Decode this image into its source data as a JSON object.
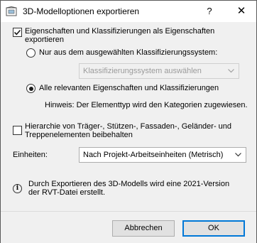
{
  "window": {
    "title": "3D-Modelloptionen exportieren",
    "help_label": "?",
    "close_label": "✕"
  },
  "export_properties": {
    "checked": true,
    "label_line1": "Eigenschaften und Klassifizierungen als Eigenschaften",
    "label_line2": "exportieren"
  },
  "radio_selected_only": {
    "selected": false,
    "label": "Nur aus dem ausgewählten Klassifizierungssystem:"
  },
  "classification_select": {
    "value": "Klassifizierungssystem auswählen",
    "disabled": true
  },
  "radio_all": {
    "selected": true,
    "label": "Alle relevanten Eigenschaften und Klassifizierungen"
  },
  "hint": "Hinweis: Der Elementtyp wird den Kategorien zugewiesen.",
  "hierarchy": {
    "checked": false,
    "label_line1": "Hierarchie von Träger-, Stützen-, Fassaden-, Geländer- und",
    "label_line2": "Treppenelementen beibehalten"
  },
  "units": {
    "label": "Einheiten:",
    "value": "Nach Projekt-Arbeitseinheiten (Metrisch)"
  },
  "info": {
    "line1": "Durch Exportieren des 3D-Modells wird eine 2021-Version",
    "line2": "der RVT-Datei erstellt."
  },
  "buttons": {
    "cancel": "Abbrechen",
    "ok": "OK"
  }
}
